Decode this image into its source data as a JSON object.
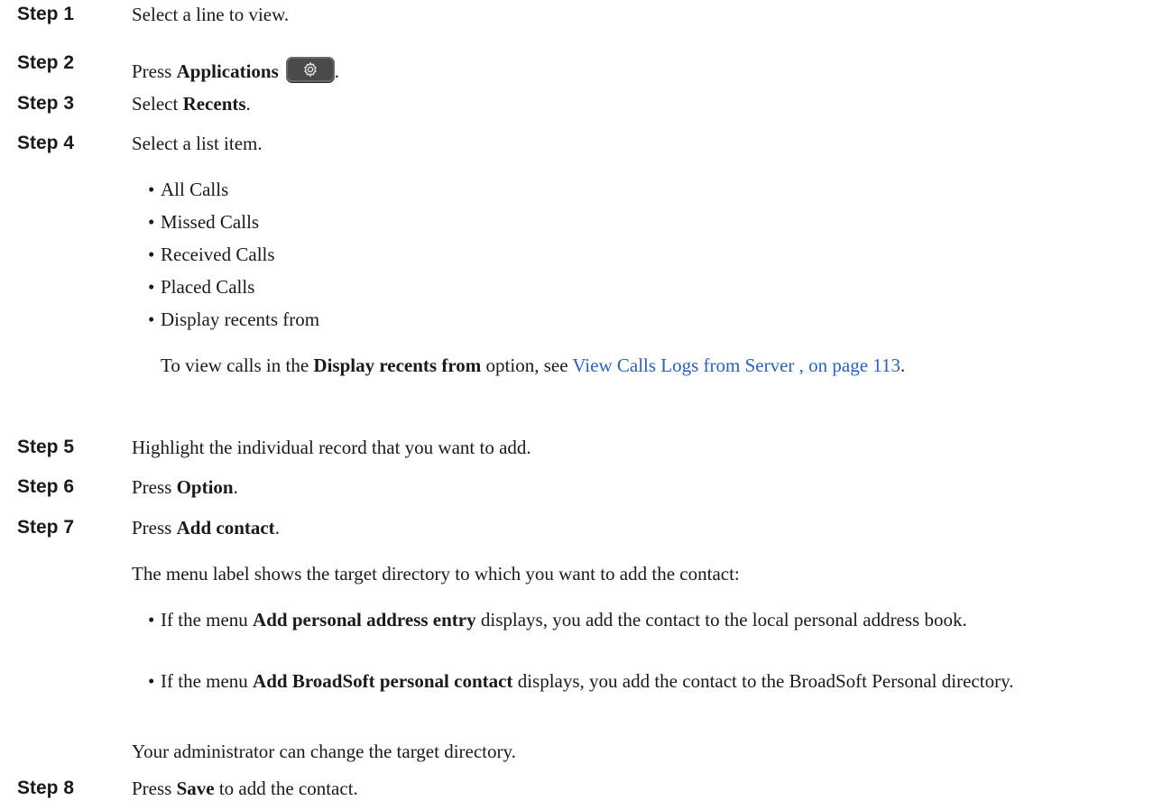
{
  "steps": [
    {
      "label": "Step 1",
      "text": "Select a line to view."
    },
    {
      "label": "Step 2",
      "pre": "Press ",
      "bold": "Applications",
      "post": "."
    },
    {
      "label": "Step 3",
      "pre": "Select ",
      "bold": "Recents",
      "post": "."
    },
    {
      "label": "Step 4",
      "text": "Select a list item."
    },
    {
      "label": "Step 5",
      "text": "Highlight the individual record that you want to add."
    },
    {
      "label": "Step 6",
      "pre": "Press ",
      "bold": "Option",
      "post": "."
    },
    {
      "label": "Step 7",
      "pre": "Press ",
      "bold": "Add contact",
      "post": "."
    },
    {
      "label": "Step 8",
      "pre": "Press ",
      "bold": "Save",
      "post": " to add the contact."
    }
  ],
  "list_items": [
    "All Calls",
    "Missed Calls",
    "Received Calls",
    "Placed Calls",
    "Display recents from"
  ],
  "step4_note": {
    "pre": "To view calls in the ",
    "bold": "Display recents from",
    "mid": " option, see ",
    "link": "View Calls Logs from Server , on page 113",
    "post": "."
  },
  "step7_intro": "The menu label shows the target directory to which you want to add the contact:",
  "step7_bullets": [
    {
      "pre": "If the menu ",
      "bold": "Add personal address entry",
      "post": " displays, you add the contact to the local personal address book."
    },
    {
      "pre": "If the menu ",
      "bold": "Add BroadSoft personal contact",
      "post": " displays, you add the contact to the BroadSoft Personal directory."
    }
  ],
  "step7_note": "Your administrator can change the target directory.",
  "icons": {
    "applications": "gear-icon"
  }
}
